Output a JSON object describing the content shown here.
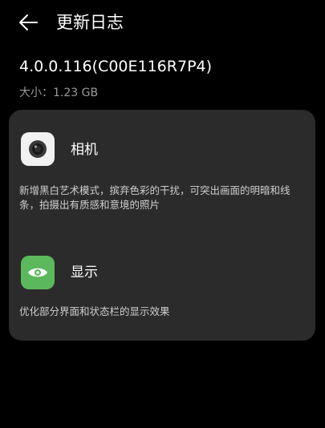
{
  "header": {
    "back_icon": "arrow-left-icon",
    "title": "更新日志"
  },
  "version": "4.0.0.116(C00E116R7P4)",
  "size": {
    "label": "大小：",
    "value": "1.23 GB"
  },
  "changelog": {
    "items": [
      {
        "icon": "camera-icon",
        "title": "相机",
        "description": "新增黑白艺术模式，摈弃色彩的干扰，可突出画面的明暗和线条，拍摄出有质感和意境的照片"
      },
      {
        "icon": "eye-icon",
        "title": "显示",
        "description": "优化部分界面和状态栏的显示效果"
      }
    ]
  },
  "colors": {
    "background": "#000000",
    "card": "#2b2b2b",
    "display_icon_bg": "#5cb85c",
    "camera_icon_bg": "#f1f1f1",
    "secondary_text": "#9a9a9a"
  }
}
